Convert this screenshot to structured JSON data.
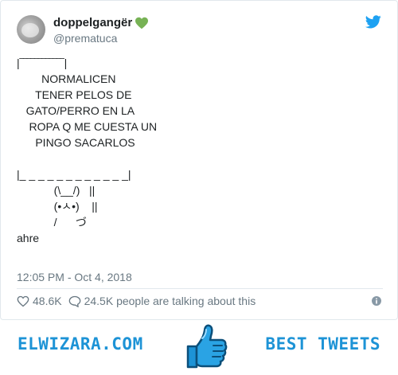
{
  "tweet": {
    "author": {
      "display_name": "doppelgangër",
      "handle": "@prematuca",
      "name_emoji": "green-heart-icon"
    },
    "text": "|‾‾‾‾‾‾‾‾‾‾‾‾|\n        NORMALICEN\n      TENER PELOS DE\n   GATO/PERRO EN LA\n    ROPA Q ME CUESTA UN\n      PINGO SACARLOS\n\n|_ _ _ _ _ _ _ _ _ _ _ _|\n            (\\__/)   ||\n            (•ㅅ•)    ||\n            /      づ\nahre",
    "timestamp": "12:05 PM - Oct 4, 2018",
    "likes": "48.6K",
    "replies_text": "24.5K people are talking about this"
  },
  "footer": {
    "left_brand": "ELWIZARA.COM",
    "right_brand": "BEST TWEETS"
  },
  "colors": {
    "twitter_blue": "#1da1f2",
    "brand_blue": "#1d93d6",
    "muted_text": "#697882"
  }
}
